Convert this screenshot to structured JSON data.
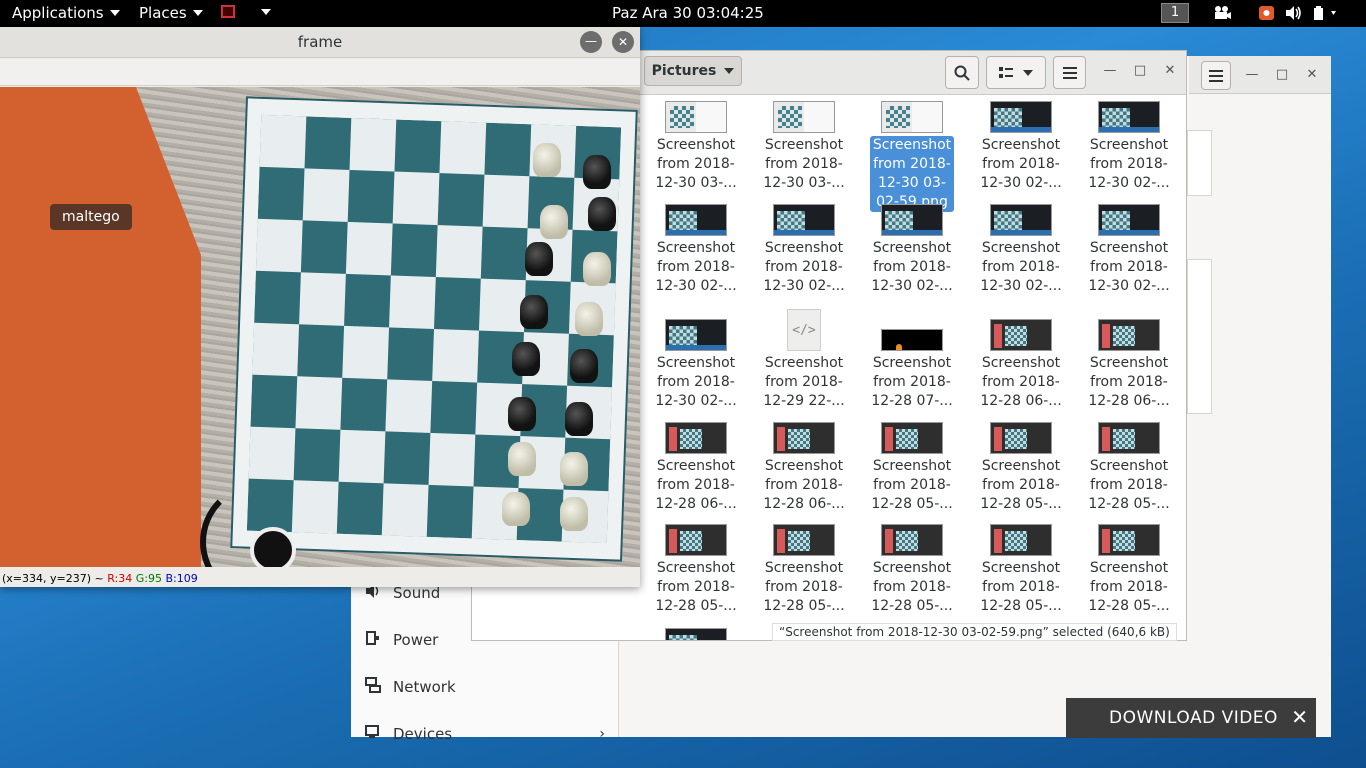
{
  "topbar": {
    "applications": "Applications",
    "places": "Places",
    "clock": "Paz Ara 30  03:04:25",
    "workspace": "1"
  },
  "frame_window": {
    "title": "frame",
    "overlay_label": "maltego",
    "coords_prefix": "(x=334, y=237) ~ ",
    "r": "R:34",
    "g": "G:95",
    "b": "B:109"
  },
  "files": {
    "location": "Pictures",
    "items": [
      {
        "line1": "Screenshot",
        "line2": "from 2018-",
        "line3": "12-30 03-..."
      },
      {
        "line1": "Screenshot",
        "line2": "from 2018-",
        "line3": "12-30 03-..."
      },
      {
        "line1": "Screenshot",
        "line2": "from 2018-",
        "line3": "12-30 03-",
        "line4": "02-59.png"
      },
      {
        "line1": "Screenshot",
        "line2": "from 2018-",
        "line3": "12-30 02-..."
      },
      {
        "line1": "Screenshot",
        "line2": "from 2018-",
        "line3": "12-30 02-..."
      },
      {
        "line1": "Screenshot",
        "line2": "from 2018-",
        "line3": "12-30 02-..."
      },
      {
        "line1": "Screenshot",
        "line2": "from 2018-",
        "line3": "12-30 02-..."
      },
      {
        "line1": "Screenshot",
        "line2": "from 2018-",
        "line3": "12-30 02-..."
      },
      {
        "line1": "Screenshot",
        "line2": "from 2018-",
        "line3": "12-30 02-..."
      },
      {
        "line1": "Screenshot",
        "line2": "from 2018-",
        "line3": "12-30 02-..."
      },
      {
        "line1": "Screenshot",
        "line2": "from 2018-",
        "line3": "12-30 02-..."
      },
      {
        "line1": "Screenshot",
        "line2": "from 2018-",
        "line3": "12-29 22-..."
      },
      {
        "line1": "Screenshot",
        "line2": "from 2018-",
        "line3": "12-28 07-..."
      },
      {
        "line1": "Screenshot",
        "line2": "from 2018-",
        "line3": "12-28 06-..."
      },
      {
        "line1": "Screenshot",
        "line2": "from 2018-",
        "line3": "12-28 06-..."
      },
      {
        "line1": "Screenshot",
        "line2": "from 2018-",
        "line3": "12-28 06-..."
      },
      {
        "line1": "Screenshot",
        "line2": "from 2018-",
        "line3": "12-28 06-..."
      },
      {
        "line1": "Screenshot",
        "line2": "from 2018-",
        "line3": "12-28 05-..."
      },
      {
        "line1": "Screenshot",
        "line2": "from 2018-",
        "line3": "12-28 05-..."
      },
      {
        "line1": "Screenshot",
        "line2": "from 2018-",
        "line3": "12-28 05-..."
      },
      {
        "line1": "Screenshot",
        "line2": "from 2018-",
        "line3": "12-28 05-..."
      },
      {
        "line1": "Screenshot",
        "line2": "from 2018-",
        "line3": "12-28 05-..."
      },
      {
        "line1": "Screenshot",
        "line2": "from 2018-",
        "line3": "12-28 05-..."
      },
      {
        "line1": "Screenshot",
        "line2": "from 2018-",
        "line3": "12-28 05-..."
      },
      {
        "line1": "Screenshot",
        "line2": "from 2018-",
        "line3": "12-28 05-..."
      }
    ],
    "status": "“Screenshot from 2018-12-30 03-02-59.png” selected  (640,6 kB)"
  },
  "settings": {
    "sidebar": [
      {
        "label": "Sound",
        "icon": "speaker-icon"
      },
      {
        "label": "Power",
        "icon": "power-icon"
      },
      {
        "label": "Network",
        "icon": "network-icon"
      },
      {
        "label": "Devices",
        "icon": "devices-icon"
      }
    ]
  },
  "download": {
    "label": "DOWNLOAD VIDEO",
    "close": "✕"
  }
}
